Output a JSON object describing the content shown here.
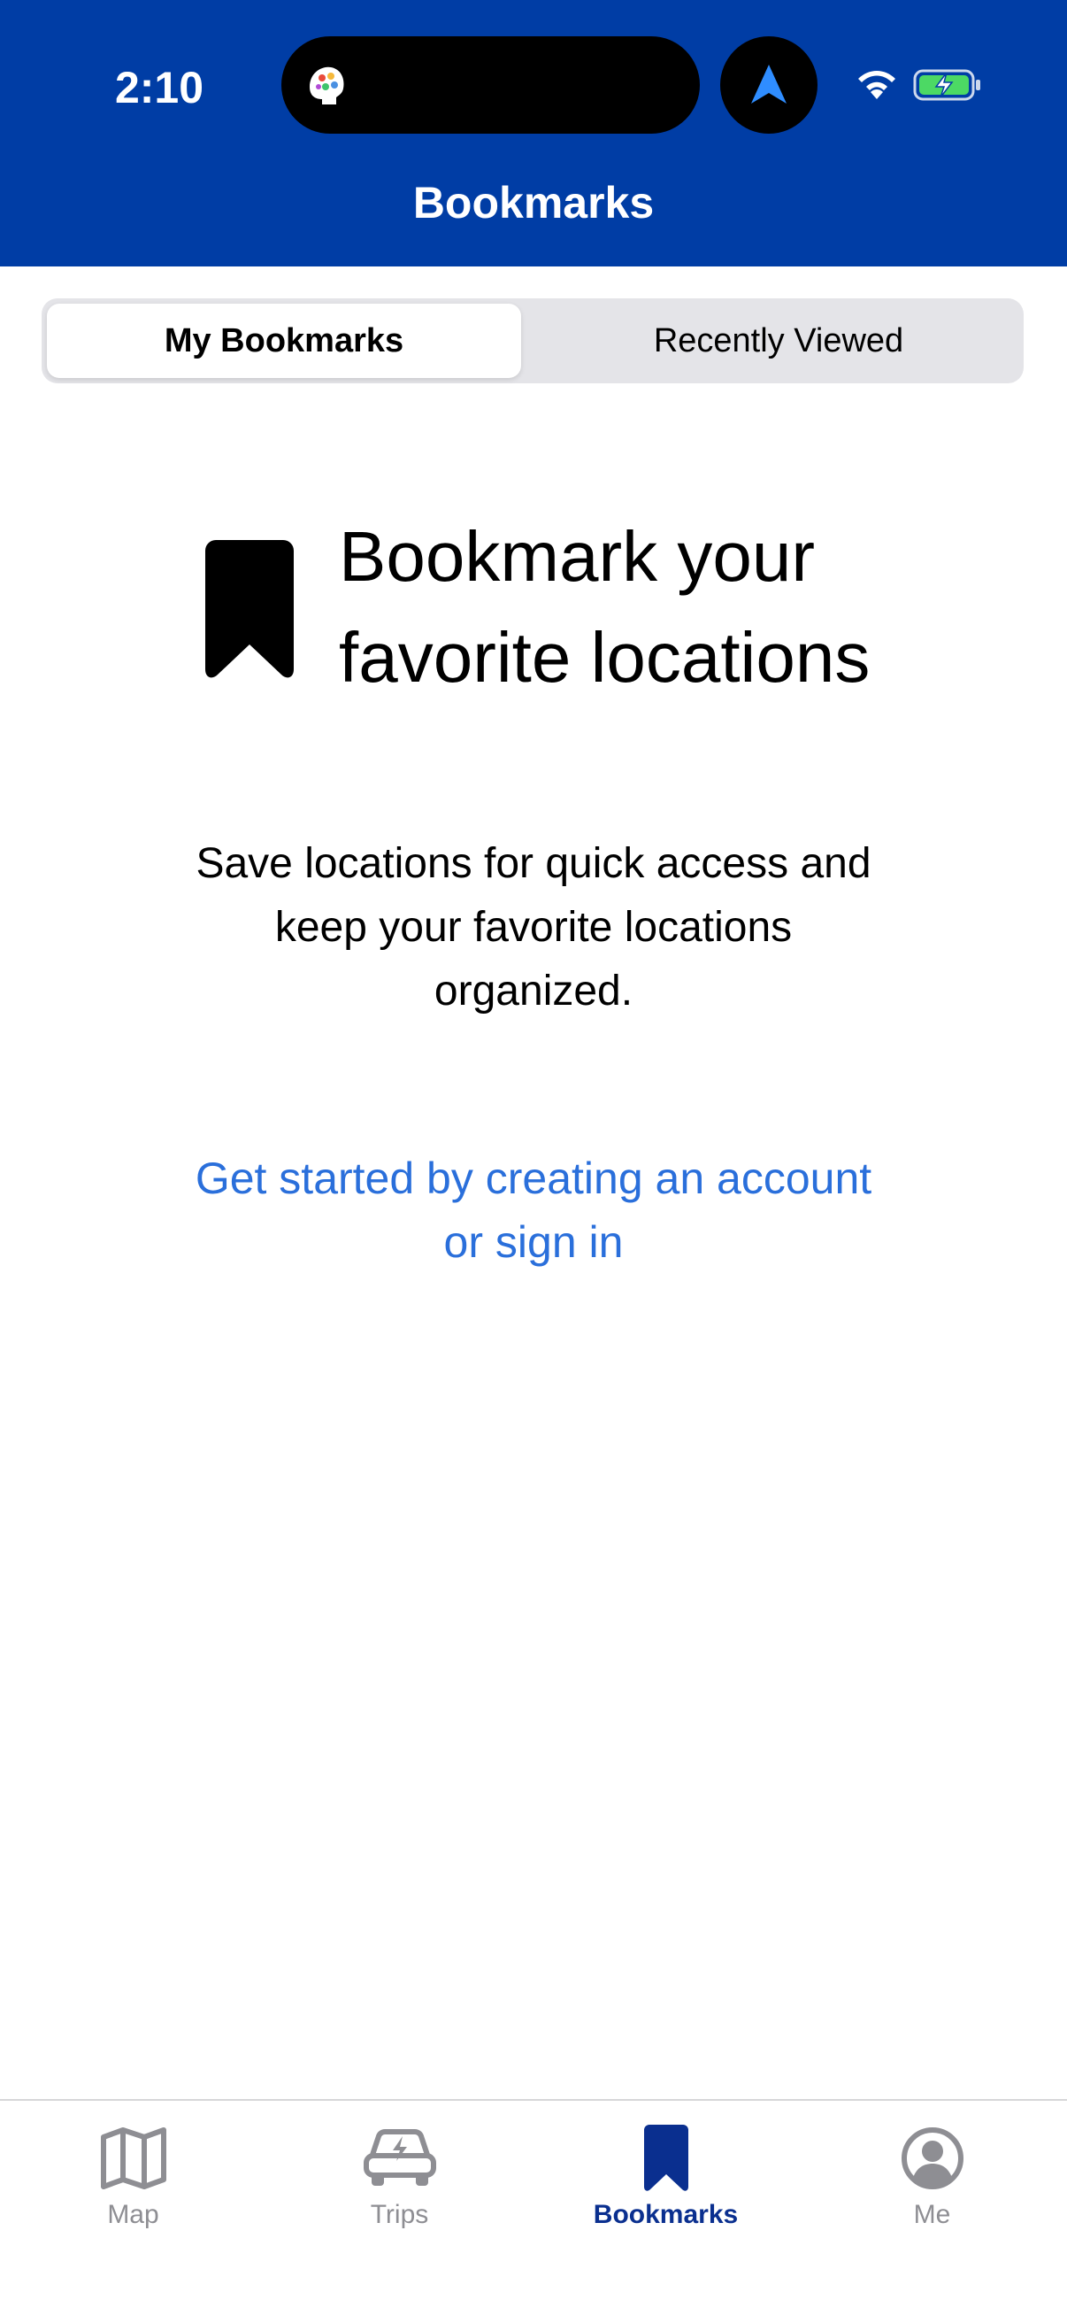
{
  "status_bar": {
    "time": "2:10",
    "app_icon": "brain-app-icon",
    "nav_icon": "navigation-arrow-icon",
    "wifi_icon": "wifi-icon",
    "battery_icon": "battery-charging-icon"
  },
  "header": {
    "title": "Bookmarks",
    "background_color": "#003DA5"
  },
  "segmented_control": {
    "selected": "My Bookmarks",
    "segments": [
      "My Bookmarks",
      "Recently Viewed"
    ]
  },
  "empty_state": {
    "icon": "bookmark-icon",
    "title_line1": "Bookmark your",
    "title_line2": "favorite locations",
    "description_line1": "Save locations for quick access and",
    "description_line2": "keep your favorite locations",
    "description_line3": "organized.",
    "link_line1": "Get started by creating an account",
    "link_line2": "or sign in",
    "link_color": "#2a6fdb"
  },
  "tab_bar": {
    "active_color": "#0A2F8F",
    "inactive_color": "#8e8e93",
    "items": [
      {
        "label": "Map",
        "icon": "map-icon",
        "active": false
      },
      {
        "label": "Trips",
        "icon": "car-lightning-icon",
        "active": false
      },
      {
        "label": "Bookmarks",
        "icon": "bookmark-icon",
        "active": true
      },
      {
        "label": "Me",
        "icon": "person-circle-icon",
        "active": false
      }
    ]
  }
}
